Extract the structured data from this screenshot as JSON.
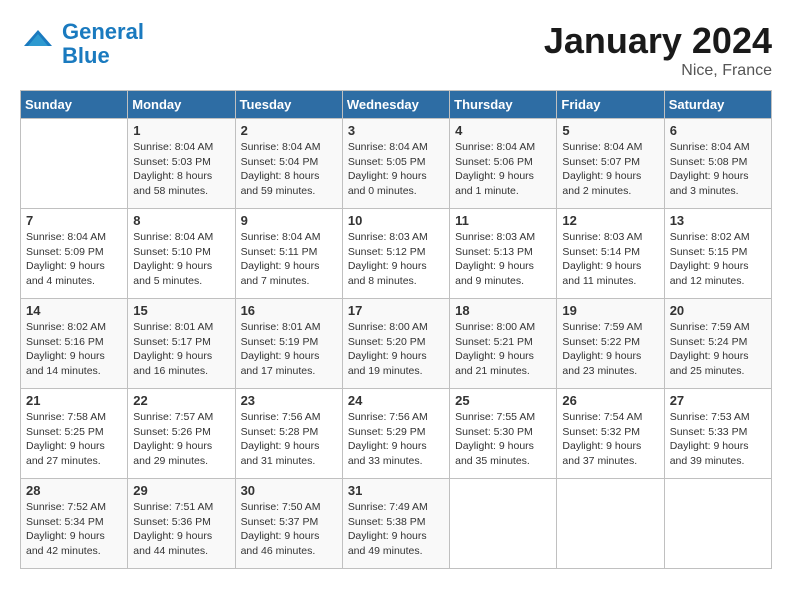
{
  "logo": {
    "line1": "General",
    "line2": "Blue"
  },
  "title": "January 2024",
  "location": "Nice, France",
  "weekdays": [
    "Sunday",
    "Monday",
    "Tuesday",
    "Wednesday",
    "Thursday",
    "Friday",
    "Saturday"
  ],
  "weeks": [
    [
      {
        "day": "",
        "info": ""
      },
      {
        "day": "1",
        "info": "Sunrise: 8:04 AM\nSunset: 5:03 PM\nDaylight: 8 hours\nand 58 minutes."
      },
      {
        "day": "2",
        "info": "Sunrise: 8:04 AM\nSunset: 5:04 PM\nDaylight: 8 hours\nand 59 minutes."
      },
      {
        "day": "3",
        "info": "Sunrise: 8:04 AM\nSunset: 5:05 PM\nDaylight: 9 hours\nand 0 minutes."
      },
      {
        "day": "4",
        "info": "Sunrise: 8:04 AM\nSunset: 5:06 PM\nDaylight: 9 hours\nand 1 minute."
      },
      {
        "day": "5",
        "info": "Sunrise: 8:04 AM\nSunset: 5:07 PM\nDaylight: 9 hours\nand 2 minutes."
      },
      {
        "day": "6",
        "info": "Sunrise: 8:04 AM\nSunset: 5:08 PM\nDaylight: 9 hours\nand 3 minutes."
      }
    ],
    [
      {
        "day": "7",
        "info": "Sunrise: 8:04 AM\nSunset: 5:09 PM\nDaylight: 9 hours\nand 4 minutes."
      },
      {
        "day": "8",
        "info": "Sunrise: 8:04 AM\nSunset: 5:10 PM\nDaylight: 9 hours\nand 5 minutes."
      },
      {
        "day": "9",
        "info": "Sunrise: 8:04 AM\nSunset: 5:11 PM\nDaylight: 9 hours\nand 7 minutes."
      },
      {
        "day": "10",
        "info": "Sunrise: 8:03 AM\nSunset: 5:12 PM\nDaylight: 9 hours\nand 8 minutes."
      },
      {
        "day": "11",
        "info": "Sunrise: 8:03 AM\nSunset: 5:13 PM\nDaylight: 9 hours\nand 9 minutes."
      },
      {
        "day": "12",
        "info": "Sunrise: 8:03 AM\nSunset: 5:14 PM\nDaylight: 9 hours\nand 11 minutes."
      },
      {
        "day": "13",
        "info": "Sunrise: 8:02 AM\nSunset: 5:15 PM\nDaylight: 9 hours\nand 12 minutes."
      }
    ],
    [
      {
        "day": "14",
        "info": "Sunrise: 8:02 AM\nSunset: 5:16 PM\nDaylight: 9 hours\nand 14 minutes."
      },
      {
        "day": "15",
        "info": "Sunrise: 8:01 AM\nSunset: 5:17 PM\nDaylight: 9 hours\nand 16 minutes."
      },
      {
        "day": "16",
        "info": "Sunrise: 8:01 AM\nSunset: 5:19 PM\nDaylight: 9 hours\nand 17 minutes."
      },
      {
        "day": "17",
        "info": "Sunrise: 8:00 AM\nSunset: 5:20 PM\nDaylight: 9 hours\nand 19 minutes."
      },
      {
        "day": "18",
        "info": "Sunrise: 8:00 AM\nSunset: 5:21 PM\nDaylight: 9 hours\nand 21 minutes."
      },
      {
        "day": "19",
        "info": "Sunrise: 7:59 AM\nSunset: 5:22 PM\nDaylight: 9 hours\nand 23 minutes."
      },
      {
        "day": "20",
        "info": "Sunrise: 7:59 AM\nSunset: 5:24 PM\nDaylight: 9 hours\nand 25 minutes."
      }
    ],
    [
      {
        "day": "21",
        "info": "Sunrise: 7:58 AM\nSunset: 5:25 PM\nDaylight: 9 hours\nand 27 minutes."
      },
      {
        "day": "22",
        "info": "Sunrise: 7:57 AM\nSunset: 5:26 PM\nDaylight: 9 hours\nand 29 minutes."
      },
      {
        "day": "23",
        "info": "Sunrise: 7:56 AM\nSunset: 5:28 PM\nDaylight: 9 hours\nand 31 minutes."
      },
      {
        "day": "24",
        "info": "Sunrise: 7:56 AM\nSunset: 5:29 PM\nDaylight: 9 hours\nand 33 minutes."
      },
      {
        "day": "25",
        "info": "Sunrise: 7:55 AM\nSunset: 5:30 PM\nDaylight: 9 hours\nand 35 minutes."
      },
      {
        "day": "26",
        "info": "Sunrise: 7:54 AM\nSunset: 5:32 PM\nDaylight: 9 hours\nand 37 minutes."
      },
      {
        "day": "27",
        "info": "Sunrise: 7:53 AM\nSunset: 5:33 PM\nDaylight: 9 hours\nand 39 minutes."
      }
    ],
    [
      {
        "day": "28",
        "info": "Sunrise: 7:52 AM\nSunset: 5:34 PM\nDaylight: 9 hours\nand 42 minutes."
      },
      {
        "day": "29",
        "info": "Sunrise: 7:51 AM\nSunset: 5:36 PM\nDaylight: 9 hours\nand 44 minutes."
      },
      {
        "day": "30",
        "info": "Sunrise: 7:50 AM\nSunset: 5:37 PM\nDaylight: 9 hours\nand 46 minutes."
      },
      {
        "day": "31",
        "info": "Sunrise: 7:49 AM\nSunset: 5:38 PM\nDaylight: 9 hours\nand 49 minutes."
      },
      {
        "day": "",
        "info": ""
      },
      {
        "day": "",
        "info": ""
      },
      {
        "day": "",
        "info": ""
      }
    ]
  ]
}
